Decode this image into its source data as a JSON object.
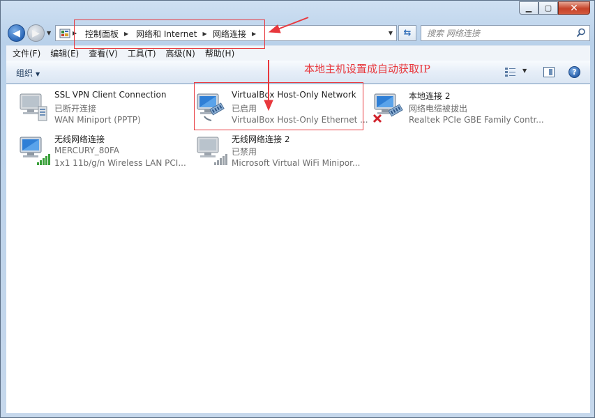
{
  "window": {
    "controls": {
      "minimize": "▁",
      "maximize": "▢",
      "close": "✕"
    }
  },
  "address_bar": {
    "crumbs": [
      "控制面板",
      "网络和 Internet",
      "网络连接"
    ]
  },
  "search": {
    "placeholder": "搜索 网络连接"
  },
  "menu": {
    "items": [
      "文件(F)",
      "编辑(E)",
      "查看(V)",
      "工具(T)",
      "高级(N)",
      "帮助(H)"
    ]
  },
  "commands": {
    "organize": "组织"
  },
  "connections": [
    {
      "name": "SSL VPN Client Connection",
      "status": "已断开连接",
      "device": "WAN Miniport (PPTP)",
      "icon": "vpn-connection-icon"
    },
    {
      "name": "VirtualBox Host-Only Network",
      "status": "已启用",
      "device": "VirtualBox Host-Only Ethernet ...",
      "icon": "ethernet-connection-icon"
    },
    {
      "name": "本地连接 2",
      "status": "网络电缆被拔出",
      "device": "Realtek PCIe GBE Family Contr...",
      "icon": "ethernet-disconnected-icon"
    },
    {
      "name": "无线网络连接",
      "status": "MERCURY_80FA",
      "device": "1x1 11b/g/n Wireless LAN PCI...",
      "icon": "wireless-connection-icon"
    },
    {
      "name": "无线网络连接 2",
      "status": "已禁用",
      "device": "Microsoft Virtual WiFi Minipor...",
      "icon": "wireless-disabled-icon"
    }
  ],
  "annotation": {
    "text": "本地主机设置成自动获取IP",
    "color": "#e8383d"
  }
}
